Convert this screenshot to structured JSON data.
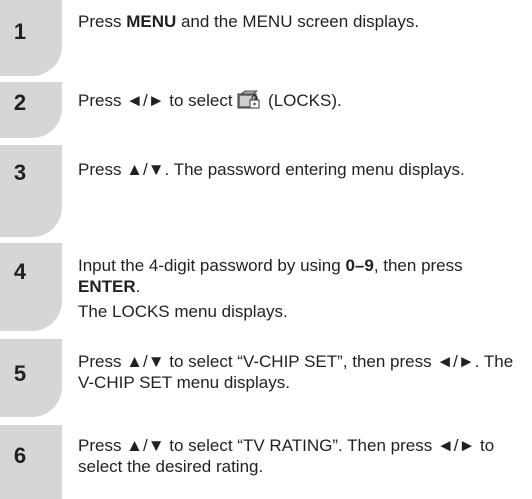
{
  "steps": [
    {
      "number": "1",
      "text": {
        "a": "Press ",
        "b": "MENU",
        "c": " and the MENU screen displays."
      }
    },
    {
      "number": "2",
      "text": {
        "a": "Press ◄/► to select ",
        "icon": "locks-icon",
        "b": " (LOCKS)."
      }
    },
    {
      "number": "3",
      "text": {
        "a": "Press ▲/▼. The password entering menu displays."
      }
    },
    {
      "number": "4",
      "text": {
        "a": "Input the 4-digit password by using ",
        "b": "0–9",
        "c": ", then press ",
        "d": "ENTER",
        "e": ".",
        "f": "The LOCKS menu displays."
      }
    },
    {
      "number": "5",
      "text": {
        "a": "Press ▲/▼ to select “V-CHIP SET”, then press ◄/►. The V-CHIP SET menu displays."
      }
    },
    {
      "number": "6",
      "text": {
        "a": "Press ▲/▼ to select “TV RATING”. Then press ◄/► to select the desired rating."
      }
    }
  ]
}
